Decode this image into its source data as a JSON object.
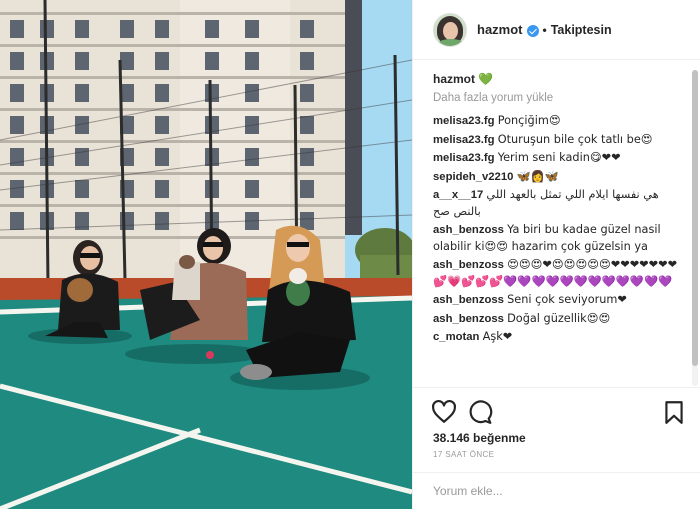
{
  "post": {
    "username": "hazmot",
    "follow_status": "Takiptesin",
    "dot": "•",
    "caption_user": "hazmot",
    "caption_emoji": "💚",
    "load_more": "Daha fazla yorum yükle",
    "likes": "38.146 beğenme",
    "time_ago": "17 SAAT ÖNCE",
    "comment_placeholder": "Yorum ekle..."
  },
  "comments": [
    {
      "user": "melisa23.fg",
      "text": "Ponçiğim😍"
    },
    {
      "user": "melisa23.fg",
      "text": "Oturuşun bile çok tatlı be😍"
    },
    {
      "user": "melisa23.fg",
      "text": "Yerim seni kadin😋❤❤"
    },
    {
      "user": "sepideh_v2210",
      "text": "🦋👩🦋"
    },
    {
      "user": "a__x__17",
      "text": "هي نفسها ايلام اللي تمثل بالعهد اللي بالنص صح"
    },
    {
      "user": "ash_benzoss",
      "text": "Ya biri bu kadae güzel nasil olabilir ki😍😍 hazarim çok güzelsin ya"
    },
    {
      "user": "ash_benzoss",
      "text": "😍😍😍❤😍😍😍😍😍❤❤❤❤❤❤❤💕💗💕💕💕💜💜💜💜💜💜💜💜💜💜💜💜"
    },
    {
      "user": "ash_benzoss",
      "text": "Seni çok seviyorum❤"
    },
    {
      "user": "ash_benzoss",
      "text": "Doğal güzellik😍😍"
    },
    {
      "user": "c_motan",
      "text": "Aşk❤"
    }
  ],
  "icons": {
    "like": "heart-icon",
    "comment": "comment-icon",
    "save": "bookmark-icon",
    "verified": "verified-badge-icon"
  },
  "colors": {
    "court": "#1f8a80",
    "court_outer": "#b94a2a",
    "verified": "#3897f0",
    "sky": "#9bd3ee"
  }
}
